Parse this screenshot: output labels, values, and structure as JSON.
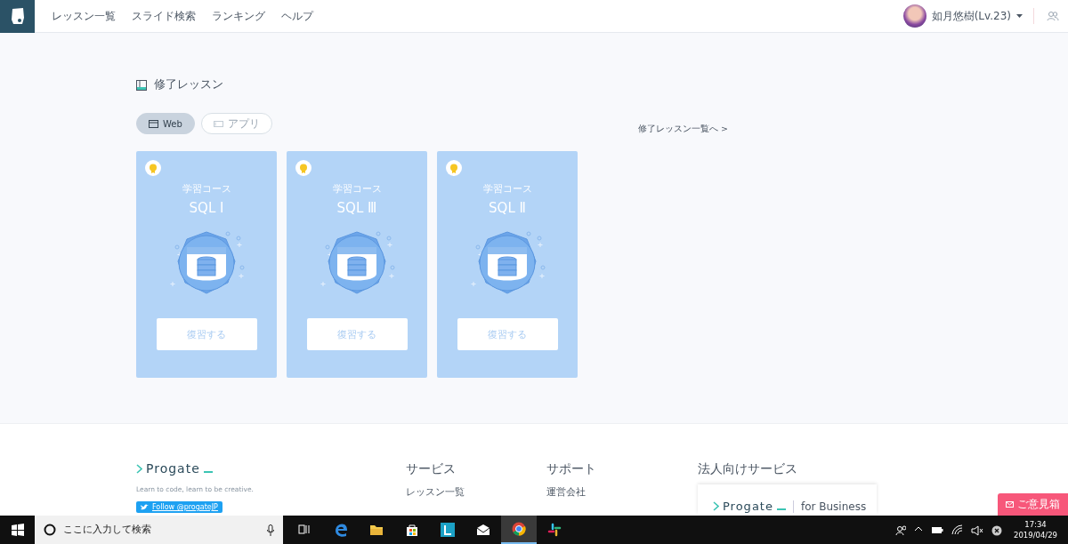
{
  "header": {
    "nav": [
      "レッスン一覧",
      "スライド検索",
      "ランキング",
      "ヘルプ"
    ],
    "user": {
      "name": "如月悠樹(Lv.23)"
    }
  },
  "section": {
    "title": "修了レッスン",
    "filters": [
      {
        "label": "Web",
        "selected": true
      },
      {
        "label": "アプリ",
        "selected": false
      }
    ],
    "all_link": "修了レッスン一覧へ >",
    "cards": [
      {
        "category": "学習コース",
        "title": "SQL I",
        "button": "復習する"
      },
      {
        "category": "学習コース",
        "title": "SQL Ⅲ",
        "button": "復習する"
      },
      {
        "category": "学習コース",
        "title": "SQL Ⅱ",
        "button": "復習する"
      }
    ]
  },
  "footer": {
    "brand": "Progate",
    "tagline": "Learn to code, learn to be creative.",
    "follow": "Follow @progateJP",
    "columns": [
      {
        "heading": "サービス",
        "links": [
          "レッスン一覧"
        ]
      },
      {
        "heading": "サポート",
        "links": [
          "運営会社"
        ]
      }
    ],
    "business": {
      "heading": "法人向けサービス",
      "brand": "Progate",
      "suffix": "for Business"
    }
  },
  "feedback": "ご意見箱",
  "taskbar": {
    "search_placeholder": "ここに入力して検索",
    "time": "17:34",
    "date": "2019/04/29"
  }
}
